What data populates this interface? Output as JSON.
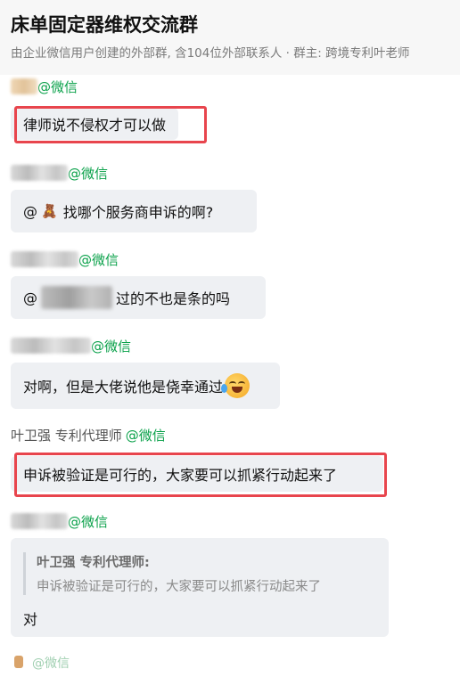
{
  "header": {
    "title": "床单固定器维权交流群",
    "subtitle": "由企业微信用户创建的外部群, 含104位外部联系人 · 群主: 跨境专利叶老师"
  },
  "messages": [
    {
      "sender_suffix": "@微信",
      "text": "律师说不侵权才可以做"
    },
    {
      "sender_suffix": "@微信",
      "text_prefix": "@",
      "text": "找哪个服务商申诉的啊?"
    },
    {
      "sender_suffix": "@微信",
      "text_prefix": "@",
      "text": "过的不也是条的吗"
    },
    {
      "sender_suffix": "@微信",
      "text": "对啊，但是大佬说他是侥幸通过"
    },
    {
      "sender_name": "叶卫强 专利代理师",
      "sender_suffix": "@微信",
      "text": "申诉被验证是可行的，大家要可以抓紧行动起来了"
    },
    {
      "sender_suffix": "@微信",
      "quote_author": "叶卫强 专利代理师:",
      "quote_text": "申诉被验证是可行的，大家要可以抓紧行动起来了",
      "text": "对"
    },
    {
      "sender_suffix": "@微信"
    }
  ],
  "colors": {
    "wechat_green": "#0aa14a",
    "highlight_red": "#e8454d",
    "bubble_bg": "#eef0f3"
  },
  "icons": [
    "teddy-bear-icon",
    "laughing-crying-emoji-icon"
  ]
}
